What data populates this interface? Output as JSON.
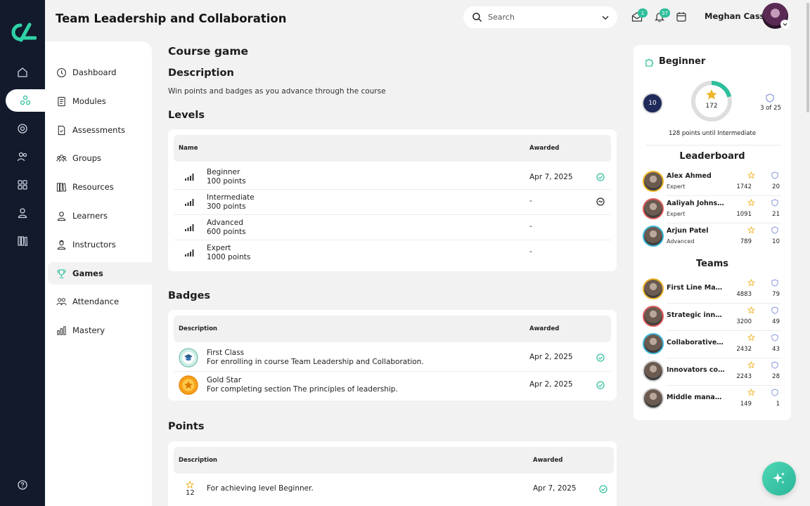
{
  "header": {
    "title": "Team Leadership and Collaboration",
    "search_placeholder": "Search",
    "messages_count": "1",
    "notifications_count": "37",
    "user_name": "Meghan Cass"
  },
  "sidebar": {
    "items": [
      {
        "label": "Dashboard",
        "icon": "dashboard-icon"
      },
      {
        "label": "Modules",
        "icon": "modules-icon"
      },
      {
        "label": "Assessments",
        "icon": "assessments-icon"
      },
      {
        "label": "Groups",
        "icon": "groups-icon"
      },
      {
        "label": "Resources",
        "icon": "resources-icon"
      },
      {
        "label": "Learners",
        "icon": "learners-icon"
      },
      {
        "label": "Instructors",
        "icon": "instructors-icon"
      },
      {
        "label": "Games",
        "icon": "trophy-icon",
        "active": true
      },
      {
        "label": "Attendance",
        "icon": "attendance-icon"
      },
      {
        "label": "Mastery",
        "icon": "mastery-icon"
      }
    ]
  },
  "main": {
    "title": "Course game",
    "description_heading": "Description",
    "description": "Win points and badges as you advance through the course",
    "levels": {
      "heading": "Levels",
      "col_name": "Name",
      "col_awarded": "Awarded",
      "rows": [
        {
          "title": "Beginner",
          "sub": "100 points",
          "awarded": "Apr 7, 2025",
          "status": "completed"
        },
        {
          "title": "Intermediate",
          "sub": "300 points",
          "awarded": "-",
          "status": "in-progress"
        },
        {
          "title": "Advanced",
          "sub": "600 points",
          "awarded": "-",
          "status": ""
        },
        {
          "title": "Expert",
          "sub": "1000 points",
          "awarded": "-",
          "status": ""
        }
      ]
    },
    "badges": {
      "heading": "Badges",
      "col_desc": "Description",
      "col_awarded": "Awarded",
      "rows": [
        {
          "title": "First Class",
          "sub": "For enrolling in course Team Leadership and Collaboration.",
          "awarded": "Apr 2, 2025",
          "status": "completed"
        },
        {
          "title": "Gold Star",
          "sub": "For completing section The principles of leadership.",
          "awarded": "Apr 2, 2025",
          "status": "completed"
        }
      ]
    },
    "points": {
      "heading": "Points",
      "col_desc": "Description",
      "col_awarded": "Awarded",
      "rows": [
        {
          "points": "12",
          "desc": "For achieving level Beginner.",
          "awarded": "Apr 7, 2025",
          "status": "completed"
        }
      ]
    }
  },
  "panel": {
    "level_title": "Beginner",
    "rank": "10",
    "points": "172",
    "points_progress": 0.21,
    "badges_count": "3 of 25",
    "until_next": "128 points until Intermediate",
    "leaderboard_heading": "Leaderboard",
    "leaderboard": [
      {
        "name": "Alex Ahmed",
        "level": "Expert",
        "points": "1742",
        "badges": "20",
        "ring": "#f0b429"
      },
      {
        "name": "Aaliyah Johnson",
        "level": "Expert",
        "points": "1091",
        "badges": "21",
        "ring": "#e05a5a"
      },
      {
        "name": "Arjun Patel",
        "level": "Advanced",
        "points": "789",
        "badges": "10",
        "ring": "#3bb3d6"
      }
    ],
    "teams_heading": "Teams",
    "teams": [
      {
        "name": "First Line Mana...",
        "points": "4883",
        "badges": "79",
        "ring": "#f0b429"
      },
      {
        "name": "Strategic innov...",
        "points": "3200",
        "badges": "49",
        "ring": "#e05a5a"
      },
      {
        "name": "Collaborative ...",
        "points": "2432",
        "badges": "43",
        "ring": "#3bb3d6"
      },
      {
        "name": "Innovators coll...",
        "points": "2243",
        "badges": "28",
        "ring": "#cfcfcf"
      },
      {
        "name": "Middle manage...",
        "points": "149",
        "badges": "1",
        "ring": "#cfcfcf"
      }
    ]
  },
  "colors": {
    "accent": "#2fbf9c",
    "rail": "#121a2c",
    "star": "#f0b429",
    "shield": "#7b8fd6"
  }
}
